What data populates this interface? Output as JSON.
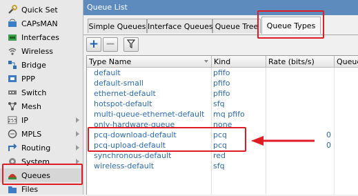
{
  "sidebar": {
    "items": [
      {
        "label": "Quick Set",
        "icon": "wrench-icon"
      },
      {
        "label": "CAPsMAN",
        "icon": "capsman-icon"
      },
      {
        "label": "Interfaces",
        "icon": "interfaces-icon"
      },
      {
        "label": "Wireless",
        "icon": "wireless-icon"
      },
      {
        "label": "Bridge",
        "icon": "bridge-icon"
      },
      {
        "label": "PPP",
        "icon": "ppp-icon"
      },
      {
        "label": "Switch",
        "icon": "switch-icon"
      },
      {
        "label": "Mesh",
        "icon": "mesh-icon"
      },
      {
        "label": "IP",
        "icon": "ip-icon",
        "submenu": true
      },
      {
        "label": "MPLS",
        "icon": "mpls-icon",
        "submenu": true
      },
      {
        "label": "Routing",
        "icon": "routing-icon",
        "submenu": true
      },
      {
        "label": "System",
        "icon": "system-icon",
        "submenu": true
      },
      {
        "label": "Queues",
        "icon": "queues-icon",
        "selected": true
      },
      {
        "label": "Files",
        "icon": "files-icon"
      }
    ]
  },
  "window": {
    "title": "Queue List",
    "tabs": [
      {
        "label": "Simple Queues"
      },
      {
        "label": "Interface Queues"
      },
      {
        "label": "Queue Tree"
      },
      {
        "label": "Queue Types",
        "active": true
      }
    ],
    "toolbar": {
      "add": "+",
      "remove": "−",
      "filter_icon": "filter-icon"
    }
  },
  "table": {
    "columns": [
      "Type Name",
      "Kind",
      "Rate (bits/s)",
      "Queue"
    ],
    "rows": [
      {
        "name": "default",
        "kind": "pfifo",
        "rate": ""
      },
      {
        "name": "default-small",
        "kind": "pfifo",
        "rate": ""
      },
      {
        "name": "ethernet-default",
        "kind": "pfifo",
        "rate": ""
      },
      {
        "name": "hotspot-default",
        "kind": "sfq",
        "rate": ""
      },
      {
        "name": "multi-queue-ethernet-default",
        "kind": "mq pfifo",
        "rate": ""
      },
      {
        "name": "only-hardware-queue",
        "kind": "none",
        "rate": ""
      },
      {
        "name": "pcq-download-default",
        "kind": "pcq",
        "rate": "0"
      },
      {
        "name": "pcq-upload-default",
        "kind": "pcq",
        "rate": "0"
      },
      {
        "name": "synchronous-default",
        "kind": "red",
        "rate": ""
      },
      {
        "name": "wireless-default",
        "kind": "sfq",
        "rate": ""
      }
    ]
  },
  "colors": {
    "title_bar": "#5e8bbd",
    "row_text": "#2b6cb7",
    "highlight": "#e01b24"
  }
}
